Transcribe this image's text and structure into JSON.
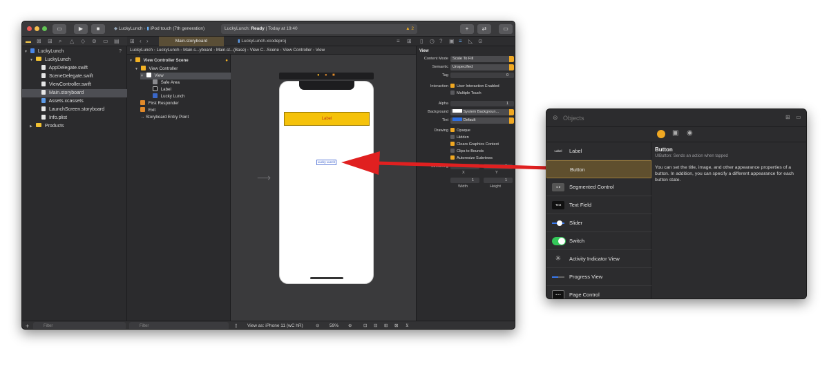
{
  "toolbar": {
    "scheme": "LuckyLunch",
    "device": "iPod touch (7th generation)",
    "activity_project": "LuckyLunch:",
    "activity_status": "Ready",
    "activity_time": "| Today at 19:40",
    "warning_count": "2",
    "plus_label": "+"
  },
  "navigator": {
    "items": [
      {
        "label": "LuckyLunch",
        "kind": "project",
        "badge": "?"
      },
      {
        "label": "LuckyLunch",
        "kind": "folder"
      },
      {
        "label": "AppDelegate.swift",
        "kind": "swift"
      },
      {
        "label": "SceneDelegate.swift",
        "kind": "swift"
      },
      {
        "label": "ViewController.swift",
        "kind": "swift"
      },
      {
        "label": "Main.storyboard",
        "kind": "storyboard"
      },
      {
        "label": "Assets.xcassets",
        "kind": "assets"
      },
      {
        "label": "LaunchScreen.storyboard",
        "kind": "storyboard"
      },
      {
        "label": "Info.plist",
        "kind": "plist"
      },
      {
        "label": "Products",
        "kind": "folder"
      }
    ],
    "filter_placeholder": "Filter"
  },
  "tabs": [
    "Main.storyboard",
    "LuckyLunch.xcodeproj"
  ],
  "jumpbar": [
    "LuckyLunch",
    "LuckyLunch",
    "Main.s...yboard",
    "Main.st...(Base)",
    "View C...Scene",
    "View Controller",
    "View"
  ],
  "outline": {
    "rows": [
      {
        "label": "View Controller Scene"
      },
      {
        "label": "View Controller"
      },
      {
        "label": "View"
      },
      {
        "label": "Safe Area"
      },
      {
        "label": "Label"
      },
      {
        "label": "Lucky Lunch"
      },
      {
        "label": "First Responder"
      },
      {
        "label": "Exit"
      },
      {
        "label": "Storyboard Entry Point"
      }
    ],
    "filter_placeholder": "Filter"
  },
  "canvas": {
    "label_text": "Label",
    "button_text": "Lucky Lunch",
    "view_as": "View as: iPhone 11 (wC hR)",
    "zoom": "59%"
  },
  "inspector": {
    "section": "View",
    "content_mode_label": "Content Mode",
    "content_mode": "Scale To Fill",
    "semantic_label": "Semantic",
    "semantic": "Unspecified",
    "tag_label": "Tag",
    "tag": "0",
    "interaction_label": "Interaction",
    "user_interaction": "User Interaction Enabled",
    "multiple_touch": "Multiple Touch",
    "alpha_label": "Alpha",
    "alpha": "1",
    "background_label": "Background",
    "background": "System Backgroun...",
    "tint_label": "Tint",
    "tint": "Default",
    "drawing_label": "Drawing",
    "opaque": "Opaque",
    "hidden": "Hidden",
    "clears_graphics": "Clears Graphics Context",
    "clips_bounds": "Clips to Bounds",
    "autoresize": "Autoresize Subviews",
    "stretching_label": "Stretching",
    "x_label": "X",
    "y_label": "Y",
    "width_label": "Width",
    "height_label": "Height",
    "stretch_x": "0",
    "stretch_y": "0",
    "stretch_w": "1",
    "stretch_h": "1"
  },
  "library": {
    "search_placeholder": "Objects",
    "items": [
      {
        "label": "Label",
        "thumb": "Label"
      },
      {
        "label": "Button",
        "thumb": ""
      },
      {
        "label": "Segmented Control",
        "thumb": "1 2"
      },
      {
        "label": "Text Field",
        "thumb": "Text"
      },
      {
        "label": "Slider",
        "thumb": ""
      },
      {
        "label": "Switch",
        "thumb": ""
      },
      {
        "label": "Activity Indicator View",
        "thumb": ""
      },
      {
        "label": "Progress View",
        "thumb": ""
      },
      {
        "label": "Page Control",
        "thumb": ""
      }
    ],
    "detail_title": "Button",
    "detail_subtitle": "UIButton: Sends an action when tapped",
    "detail_body": "You can set the title, image, and other appearance properties of a button. In addition, you can specify a different appearance for each button state."
  },
  "colors": {
    "accent": "#f0a822",
    "arrow": "#e02020",
    "label_fill": "#f5c20a",
    "switch_on": "#34c759"
  }
}
